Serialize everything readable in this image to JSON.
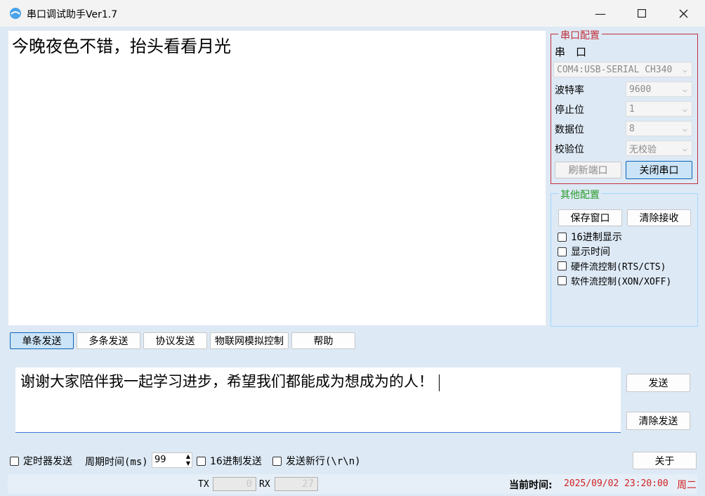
{
  "window": {
    "title": "串口调试助手Ver1.7"
  },
  "receive": {
    "text": "今晚夜色不错，抬头看看月光"
  },
  "serial": {
    "legend": "串口配置",
    "port_label": "串　口",
    "port_value": "COM4:USB-SERIAL CH340",
    "baud_label": "波特率",
    "baud_value": "9600",
    "stop_label": "停止位",
    "stop_value": "1",
    "data_label": "数据位",
    "data_value": "8",
    "parity_label": "校验位",
    "parity_value": "无校验",
    "refresh_label": "刷新端口",
    "close_label": "关闭串口"
  },
  "other": {
    "legend": "其他配置",
    "save_label": "保存窗口",
    "clear_recv_label": "清除接收",
    "hex_display": "16进制显示",
    "show_time": "显示时间",
    "hw_flow": "硬件流控制(RTS/CTS)",
    "sw_flow": "软件流控制(XON/XOFF)"
  },
  "tabs": [
    "单条发送",
    "多条发送",
    "协议发送",
    "物联网模拟控制",
    "帮助"
  ],
  "send": {
    "text": "谢谢大家陪伴我一起学习进步，希望我们都能成为想成为的人！",
    "send_label": "发送",
    "clear_label": "清除发送"
  },
  "bottom": {
    "timer_label": "定时器发送",
    "period_label": "周期时间(ms)",
    "period_value": "99",
    "hex_send": "16进制发送",
    "newline": "发送新行(\\r\\n)",
    "about_label": "关于"
  },
  "status": {
    "tx_label": "TX",
    "tx_value": "0",
    "rx_label": "RX",
    "rx_value": "27",
    "time_label": "当前时间:",
    "time_value": "2025/09/02 23:20:00",
    "weekday": "周二"
  },
  "colors": {
    "accent": "#0a64b8",
    "serial_border": "#c0303a",
    "other_legend": "#2a9d2a",
    "time_color": "#d22020"
  }
}
